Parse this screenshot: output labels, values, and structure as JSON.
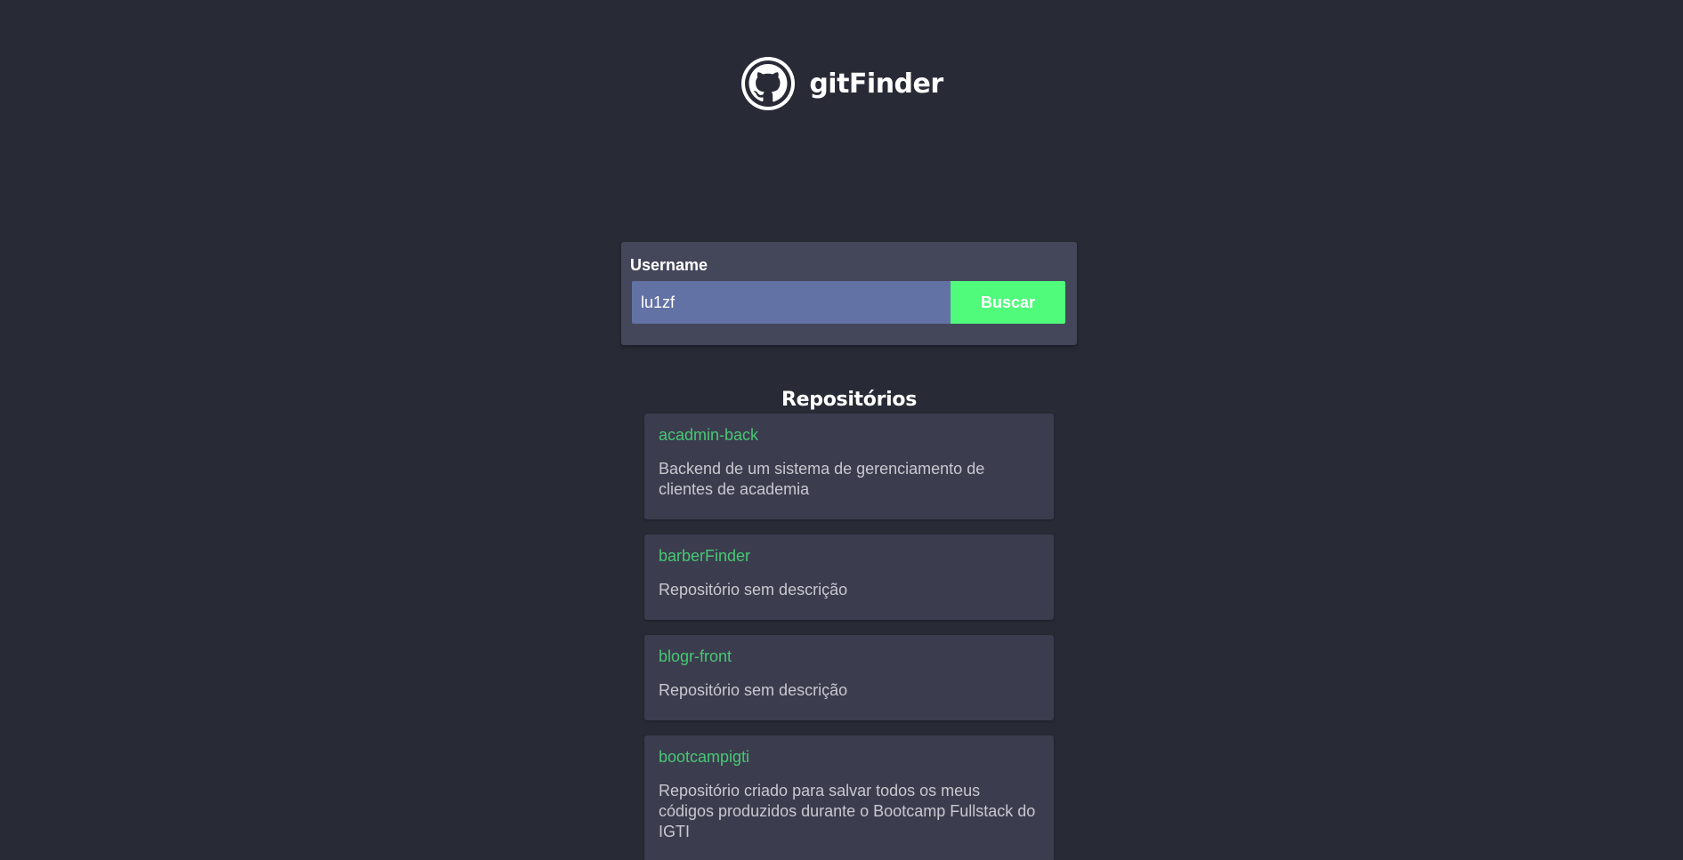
{
  "app": {
    "title": "gitFinder",
    "logo_icon": "github-octocat-icon"
  },
  "search": {
    "label": "Username",
    "value": "lu1zf",
    "placeholder": "",
    "button_label": "Buscar"
  },
  "repositories": {
    "heading": "Repositórios",
    "items": [
      {
        "name": "acadmin-back",
        "description": "Backend de um sistema de gerenciamento de clientes de academia"
      },
      {
        "name": "barberFinder",
        "description": "Repositório sem descrição"
      },
      {
        "name": "blogr-front",
        "description": "Repositório sem descrição"
      },
      {
        "name": "bootcampigti",
        "description": "Repositório criado para salvar todos os meus códigos produzidos durante o Bootcamp Fullstack do IGTI"
      }
    ]
  },
  "colors": {
    "background": "#282a36",
    "card": "#44475a",
    "input": "#6272a4",
    "accent": "#50fa7b",
    "repo_name": "#48c774"
  }
}
